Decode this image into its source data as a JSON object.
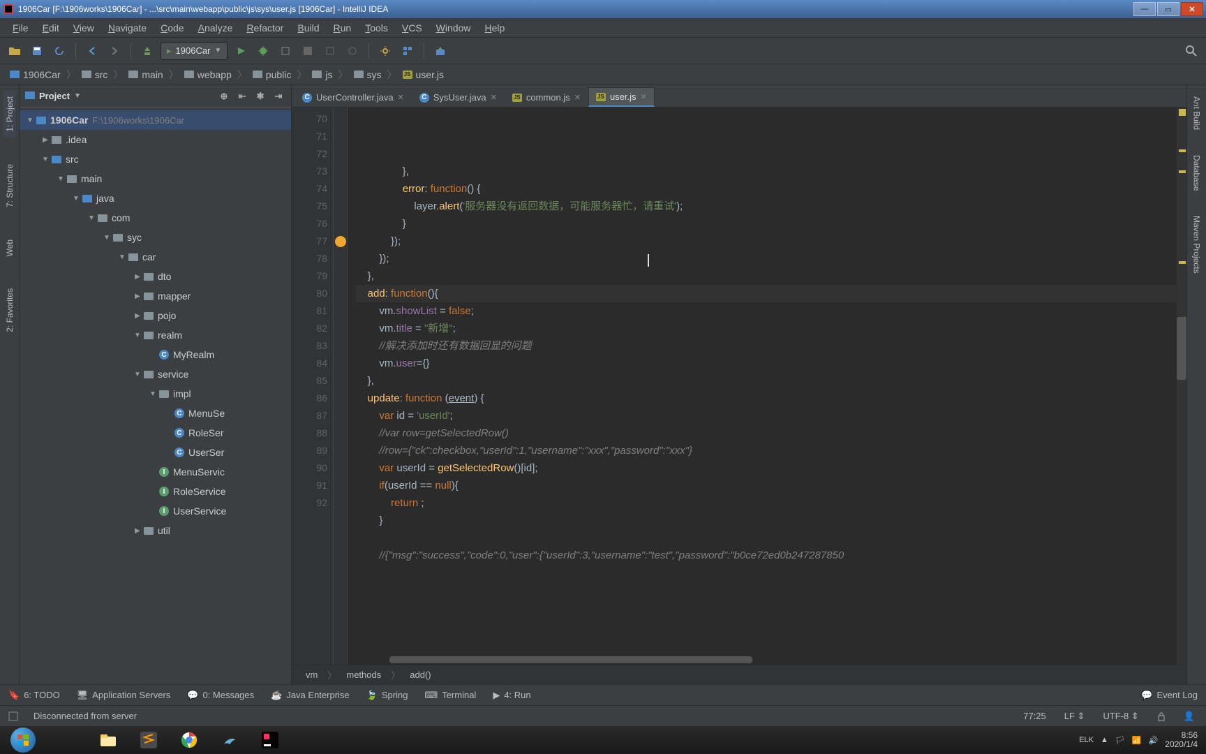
{
  "title": "1906Car [F:\\1906works\\1906Car] - ...\\src\\main\\webapp\\public\\js\\sys\\user.js [1906Car] - IntelliJ IDEA",
  "menu": [
    "File",
    "Edit",
    "View",
    "Navigate",
    "Code",
    "Analyze",
    "Refactor",
    "Build",
    "Run",
    "Tools",
    "VCS",
    "Window",
    "Help"
  ],
  "run_config": "1906Car",
  "breadcrumbs": [
    "1906Car",
    "src",
    "main",
    "webapp",
    "public",
    "js",
    "sys",
    "user.js"
  ],
  "left_tabs": [
    "1: Project",
    "7: Structure",
    "Web",
    "2: Favorites"
  ],
  "right_tabs": [
    "Ant Build",
    "Database",
    "Maven Projects"
  ],
  "project_header": "Project",
  "tree": {
    "root": "1906Car",
    "root_path": "F:\\1906works\\1906Car",
    "items": [
      ".idea",
      "src",
      "main",
      "java",
      "com",
      "syc",
      "car",
      "dto",
      "mapper",
      "pojo",
      "realm",
      "MyRealm",
      "service",
      "impl",
      "MenuSe",
      "RoleSer",
      "UserSer",
      "MenuServic",
      "RoleService",
      "UserService",
      "util"
    ]
  },
  "tabs": [
    {
      "name": "UserController.java",
      "active": false,
      "type": "class"
    },
    {
      "name": "SysUser.java",
      "active": false,
      "type": "class"
    },
    {
      "name": "common.js",
      "active": false,
      "type": "js"
    },
    {
      "name": "user.js",
      "active": true,
      "type": "js"
    }
  ],
  "code_start_line": 70,
  "code_lines": [
    "                },",
    "                error: function() {",
    "                    layer.alert('服务器没有返回数据，可能服务器忙，请重试');",
    "                }",
    "            });",
    "        });",
    "    },",
    "    add: function(){",
    "        vm.showList = false;",
    "        vm.title = \"新增\";",
    "        //解决添加时还有数据回显的问题",
    "        vm.user={}",
    "    },",
    "    update: function (event) {",
    "        var id = 'userId';",
    "        //var row=getSelectedRow()",
    "        //row={\"ck\":checkbox,\"userId\":1,\"username\":\"xxx\",\"password\":\"xxx\"}",
    "        var userId = getSelectedRow()[id];",
    "        if(userId == null){",
    "            return ;",
    "        }",
    "",
    "        //{\"msg\":\"success\",\"code\":0,\"user\":{\"userId\":3,\"username\":\"test\",\"password\":\"b0ce72ed0b247287850"
  ],
  "editor_breadcrumb": [
    "vm",
    "methods",
    "add()"
  ],
  "bottom_tabs": [
    "6: TODO",
    "Application Servers",
    "0: Messages",
    "Java Enterprise",
    "Spring",
    "Terminal",
    "4: Run"
  ],
  "event_log": "Event Log",
  "status_msg": "Disconnected from server",
  "caret": "77:25",
  "line_sep": "LF",
  "encoding": "UTF-8",
  "tray_lang": "ELK",
  "clock_time": "8:56",
  "clock_date": "2020/1/4"
}
